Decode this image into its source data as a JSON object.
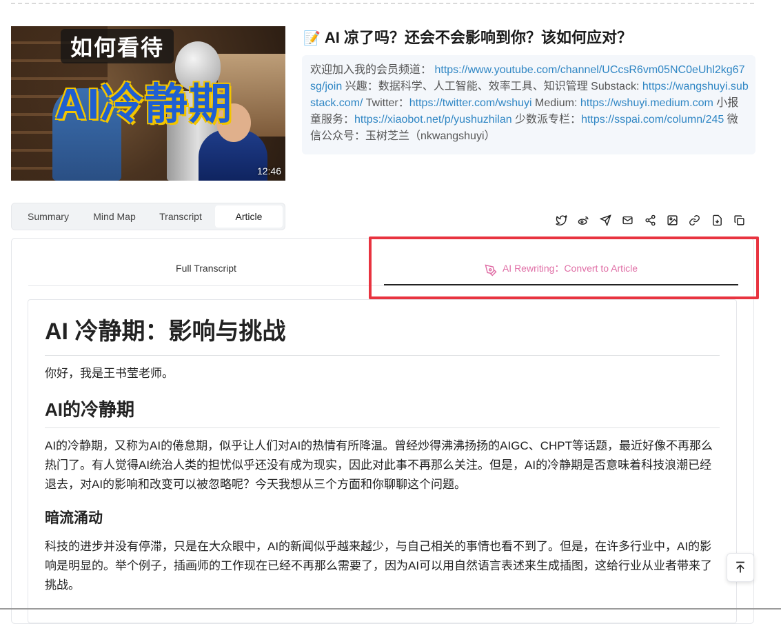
{
  "video": {
    "thumb_title_small": "如何看待",
    "thumb_title_big": "AI冷静期",
    "duration": "12:46",
    "title_icon": "memo-icon",
    "title": "AI 凉了吗？还会不会影响到你？该如何应对？"
  },
  "description": {
    "p1": "欢迎加入我的会员频道：",
    "link1": "https://www.youtube.com/channel/UCcsR6vm05NC0eUhl2kg67sg/join",
    "p2": " 兴趣：数据科学、人工智能、效率工具、知识管理 Substack: ",
    "link2": "https://wangshuyi.substack.com/",
    "p3": " Twitter：",
    "link3": "https://twitter.com/wshuyi",
    "p4": " Medium: ",
    "link4": "https://wshuyi.medium.com",
    "p5": " 小报童服务：",
    "link5": "https://xiaobot.net/p/yushuzhilan",
    "p6": " 少数派专栏：",
    "link6": "https://sspai.com/column/245",
    "p7": " 微信公众号：玉树芝兰（nkwangshuyi）"
  },
  "tabs": [
    "Summary",
    "Mind Map",
    "Transcript",
    "Article"
  ],
  "active_tab": "Article",
  "toolbar_icons": [
    "twitter-icon",
    "weibo-icon",
    "telegram-icon",
    "mail-icon",
    "share-icon",
    "image-icon",
    "link-icon",
    "download-icon",
    "copy-icon"
  ],
  "subtabs": {
    "full": "Full Transcript",
    "ai": "AI Rewriting：Convert to Article"
  },
  "colors": {
    "accent_pink": "#e06fa6",
    "highlight_red": "#e8333f",
    "link_blue": "#2f86c4"
  },
  "article": {
    "title": "AI 冷静期：影响与挑战",
    "greeting": "你好，我是王书莹老师。",
    "h2": "AI的冷静期",
    "p1": "AI的冷静期，又称为AI的倦怠期，似乎让人们对AI的热情有所降温。曾经炒得沸沸扬扬的AIGC、CHPT等话题，最近好像不再那么热门了。有人觉得AI统治人类的担忧似乎还没有成为现实，因此对此事不再那么关注。但是，AI的冷静期是否意味着科技浪潮已经退去，对AI的影响和改变可以被忽略呢？今天我想从三个方面和你聊聊这个问题。",
    "h3": "暗流涌动",
    "p2": "科技的进步并没有停滞，只是在大众眼中，AI的新闻似乎越来越少，与自己相关的事情也看不到了。但是，在许多行业中，AI的影响是明显的。举个例子，插画师的工作现在已经不再那么需要了，因为AI可以用自然语言表述来生成插图，这给行业从业者带来了挑战。"
  }
}
